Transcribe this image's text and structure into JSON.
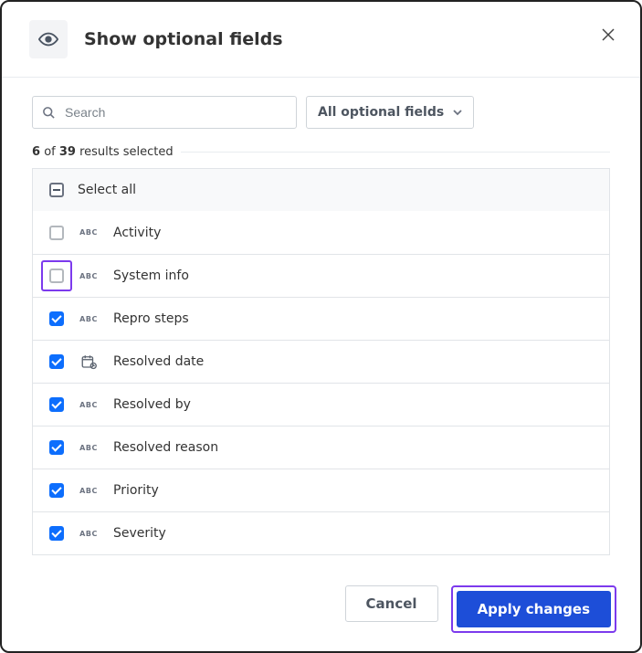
{
  "header": {
    "title": "Show optional fields"
  },
  "search": {
    "placeholder": "Search",
    "value": ""
  },
  "filter_dropdown": {
    "label": "All optional fields"
  },
  "results": {
    "selected": "6",
    "of_word": "of",
    "total": "39",
    "suffix": "results selected"
  },
  "select_all_label": "Select all",
  "fields": [
    {
      "label": "Activity",
      "checked": false,
      "type": "abc",
      "highlight": false
    },
    {
      "label": "System info",
      "checked": false,
      "type": "abc",
      "highlight": true
    },
    {
      "label": "Repro steps",
      "checked": true,
      "type": "abc",
      "highlight": false
    },
    {
      "label": "Resolved date",
      "checked": true,
      "type": "date",
      "highlight": false
    },
    {
      "label": "Resolved by",
      "checked": true,
      "type": "abc",
      "highlight": false
    },
    {
      "label": "Resolved reason",
      "checked": true,
      "type": "abc",
      "highlight": false
    },
    {
      "label": "Priority",
      "checked": true,
      "type": "abc",
      "highlight": false
    },
    {
      "label": "Severity",
      "checked": true,
      "type": "abc",
      "highlight": false
    }
  ],
  "buttons": {
    "cancel": "Cancel",
    "apply": "Apply changes"
  }
}
